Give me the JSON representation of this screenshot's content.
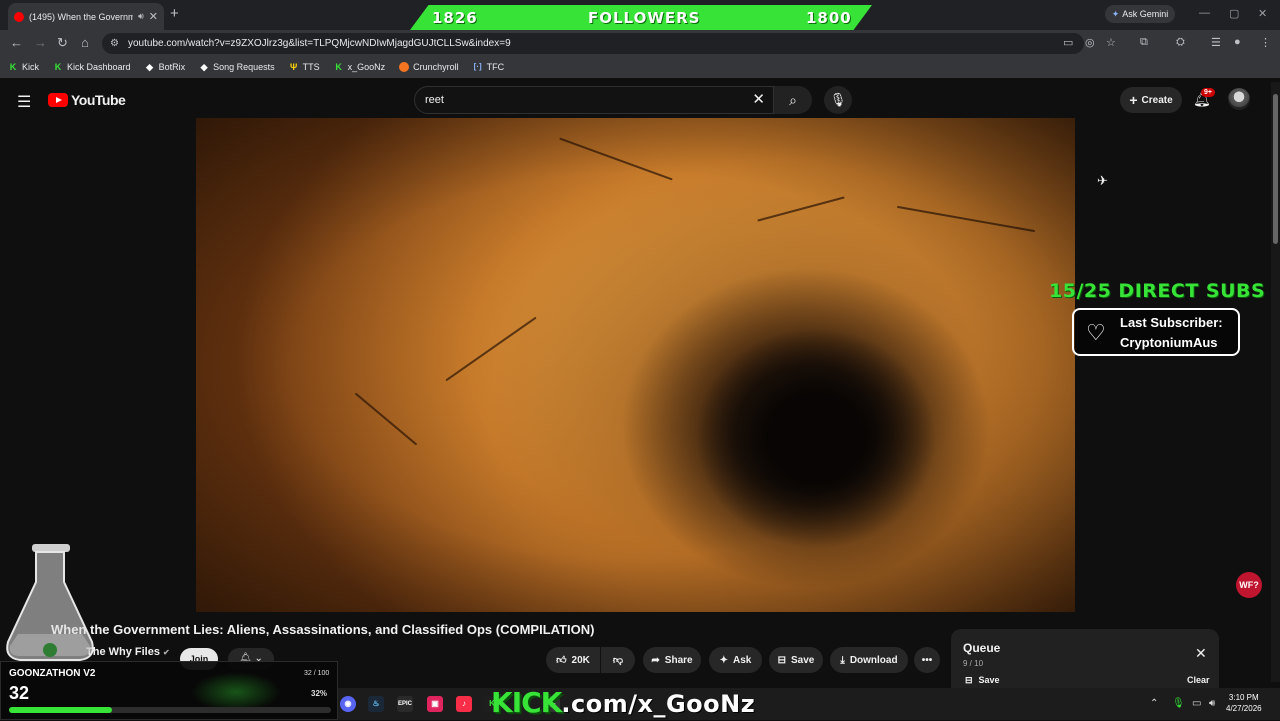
{
  "browser": {
    "tab_title": "(1495) When the Governm",
    "url": "youtube.com/watch?v=z9ZXOJlrz3g&list=TLPQMjcwNDIwMjagdGUJtCLLSw&index=9",
    "ask_gemini": "Ask Gemini",
    "bookmarks": [
      "Kick",
      "Kick Dashboard",
      "BotRix",
      "Song Requests",
      "TTS",
      "x_GooNz",
      "Crunchyroll",
      "TFC"
    ]
  },
  "followers_bar": {
    "left": "1826",
    "label": "FOLLOWERS",
    "right": "1800"
  },
  "youtube": {
    "logo_text": "YouTube",
    "search_value": "reet",
    "create_label": "Create",
    "notif_badge": "9+"
  },
  "video": {
    "title": "When the Government Lies: Aliens, Assassinations, and Classified Ops (COMPILATION)",
    "channel": "The Why Files",
    "join_label": "Join",
    "like_count": "20K",
    "actions": {
      "share": "Share",
      "ask": "Ask",
      "save": "Save",
      "download": "Download"
    }
  },
  "overlay": {
    "direct_subs": "15/25 DIRECT SUBS",
    "last_sub_label": "Last Subscriber:",
    "last_sub_name": "CryptoniumAus",
    "wf_badge": "WF?",
    "kick_prefix": "KICK",
    "kick_suffix": ".com/x_GooNz"
  },
  "queue": {
    "title": "Queue",
    "count": "9 / 10",
    "save": "Save",
    "clear": "Clear"
  },
  "goonzathon": {
    "title": "GOONZATHON V2",
    "value": "32",
    "ratio": "32 / 100",
    "percent": "32%",
    "progress": 0.32
  },
  "clock": {
    "time": "3:10 PM",
    "date": "4/27/2026"
  },
  "colors": {
    "accent_green": "#36e336",
    "yt_red": "#ff0000"
  }
}
